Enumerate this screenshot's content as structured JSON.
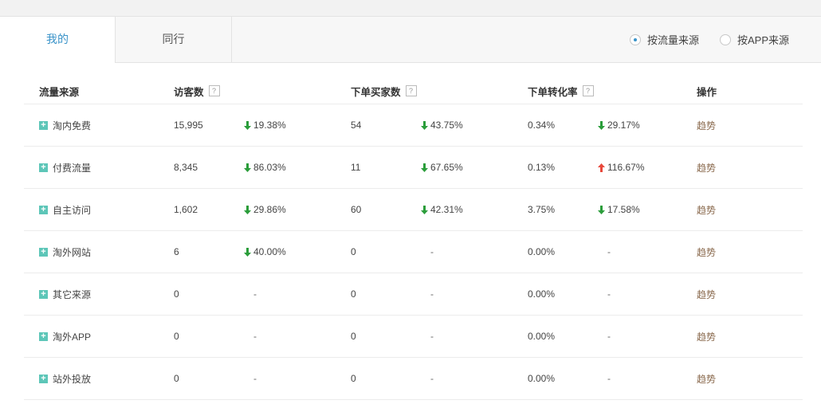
{
  "tabs": [
    {
      "label": "我的",
      "active": true
    },
    {
      "label": "同行",
      "active": false
    }
  ],
  "radios": [
    {
      "label": "按流量来源",
      "checked": true
    },
    {
      "label": "按APP来源",
      "checked": false
    }
  ],
  "headers": {
    "source": "流量来源",
    "visitors": "访客数",
    "buyers": "下单买家数",
    "rate": "下单转化率",
    "action": "操作",
    "help": "?"
  },
  "rows": [
    {
      "name": "淘内免费",
      "visitors": "15,995",
      "visitors_change": "19.38%",
      "visitors_dir": "down",
      "buyers": "54",
      "buyers_change": "43.75%",
      "buyers_dir": "down",
      "rate": "0.34%",
      "rate_change": "29.17%",
      "rate_dir": "down",
      "action": "趋势"
    },
    {
      "name": "付费流量",
      "visitors": "8,345",
      "visitors_change": "86.03%",
      "visitors_dir": "down",
      "buyers": "11",
      "buyers_change": "67.65%",
      "buyers_dir": "down",
      "rate": "0.13%",
      "rate_change": "116.67%",
      "rate_dir": "up",
      "action": "趋势"
    },
    {
      "name": "自主访问",
      "visitors": "1,602",
      "visitors_change": "29.86%",
      "visitors_dir": "down",
      "buyers": "60",
      "buyers_change": "42.31%",
      "buyers_dir": "down",
      "rate": "3.75%",
      "rate_change": "17.58%",
      "rate_dir": "down",
      "action": "趋势"
    },
    {
      "name": "淘外网站",
      "visitors": "6",
      "visitors_change": "40.00%",
      "visitors_dir": "down",
      "buyers": "0",
      "buyers_change": "-",
      "buyers_dir": "none",
      "rate": "0.00%",
      "rate_change": "-",
      "rate_dir": "none",
      "action": "趋势"
    },
    {
      "name": "其它来源",
      "visitors": "0",
      "visitors_change": "-",
      "visitors_dir": "none",
      "buyers": "0",
      "buyers_change": "-",
      "buyers_dir": "none",
      "rate": "0.00%",
      "rate_change": "-",
      "rate_dir": "none",
      "action": "趋势"
    },
    {
      "name": "淘外APP",
      "visitors": "0",
      "visitors_change": "-",
      "visitors_dir": "none",
      "buyers": "0",
      "buyers_change": "-",
      "buyers_dir": "none",
      "rate": "0.00%",
      "rate_change": "-",
      "rate_dir": "none",
      "action": "趋势"
    },
    {
      "name": "站外投放",
      "visitors": "0",
      "visitors_change": "-",
      "visitors_dir": "none",
      "buyers": "0",
      "buyers_change": "-",
      "buyers_dir": "none",
      "rate": "0.00%",
      "rate_change": "-",
      "rate_dir": "none",
      "action": "趋势"
    }
  ],
  "expand_glyph": "+",
  "colors": {
    "down": "#2a9d3a",
    "up": "#e8483b",
    "accent": "#3a93c9",
    "plus": "#5dc6b8"
  }
}
